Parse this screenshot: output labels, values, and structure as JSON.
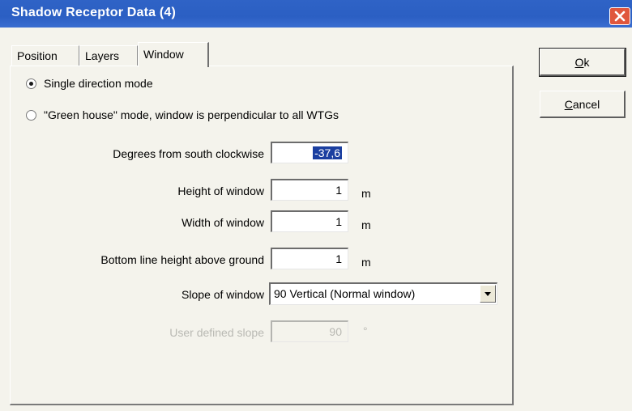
{
  "window": {
    "title": "Shadow Receptor Data   (4)",
    "close_icon": "close-icon"
  },
  "tabs": [
    {
      "label": "Position",
      "active": false
    },
    {
      "label": "Layers",
      "active": false
    },
    {
      "label": "Window",
      "active": true
    }
  ],
  "mode": {
    "single_direction_label": "Single direction mode",
    "green_house_label": "\"Green house\" mode, window is perpendicular to all WTGs",
    "selected": "single_direction"
  },
  "fields": {
    "degrees": {
      "label": "Degrees from south clockwise",
      "value": "-37,6"
    },
    "height": {
      "label": "Height of window",
      "value": "1",
      "unit": "m"
    },
    "width": {
      "label": "Width of window",
      "value": "1",
      "unit": "m"
    },
    "bottom_line": {
      "label": "Bottom line height above ground",
      "value": "1",
      "unit": "m"
    },
    "slope": {
      "label": "Slope of window",
      "value": "90 Vertical (Normal window)"
    },
    "user_slope": {
      "label": "User defined slope",
      "value": "90",
      "unit": "°",
      "disabled": true
    }
  },
  "buttons": {
    "ok_mnemonic": "O",
    "ok_rest": "k",
    "cancel_mnemonic": "C",
    "cancel_rest": "ancel"
  },
  "colors": {
    "titlebar": "#2f63c6",
    "selection": "#1b3fa0",
    "close": "#e0573d"
  }
}
